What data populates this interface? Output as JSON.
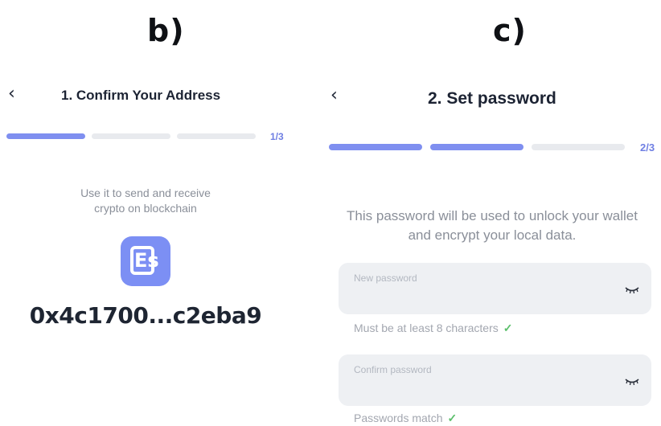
{
  "panel_b": {
    "label": "b)",
    "back_icon": "chevron-left-icon",
    "title": "1. Confirm Your Address",
    "step": "1/3",
    "progress_fraction": 0.333,
    "description_line1": "Use it to send and receive",
    "description_line2": "crypto on blockchain",
    "logo_text": "Es",
    "address": "0x4c1700...c2eba9"
  },
  "panel_c": {
    "label": "c)",
    "back_icon": "chevron-left-icon",
    "title": "2. Set password",
    "step": "2/3",
    "progress_fraction": 0.667,
    "description_line1": "This password will be used to unlock your wallet",
    "description_line2": "and encrypt your local data.",
    "new_password": {
      "placeholder": "New password",
      "hint": "Must be at least 8 characters",
      "icon": "eye-closed-icon"
    },
    "confirm_password": {
      "placeholder": "Confirm password",
      "hint": "Passwords match",
      "icon": "eye-closed-icon"
    }
  },
  "colors": {
    "accent": "#7f8ff0",
    "track": "#e8eaee",
    "logo_bg": "#7c8ff4",
    "success": "#5bbf6b"
  }
}
